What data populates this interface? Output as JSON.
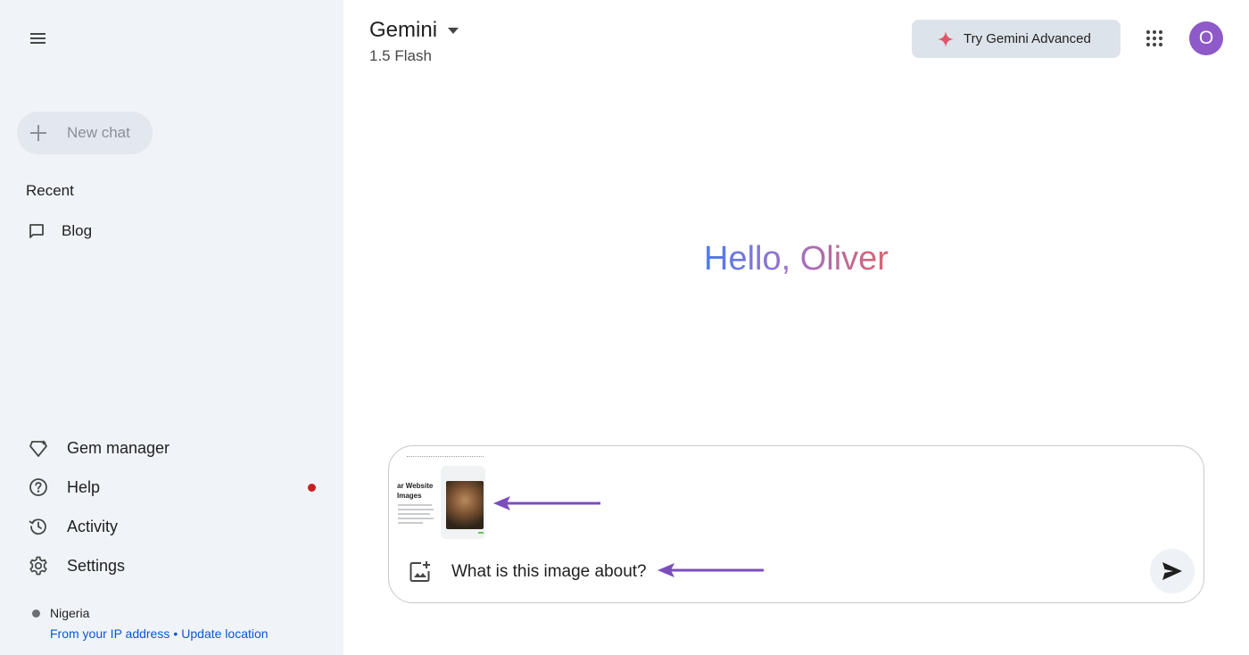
{
  "sidebar": {
    "new_chat_label": "New chat",
    "recent_heading": "Recent",
    "recent_items": [
      {
        "label": "Blog"
      }
    ],
    "links": [
      {
        "label": "Gem manager",
        "icon": "gem-icon"
      },
      {
        "label": "Help",
        "icon": "help-icon",
        "badge": true
      },
      {
        "label": "Activity",
        "icon": "history-icon"
      },
      {
        "label": "Settings",
        "icon": "gear-icon"
      }
    ],
    "location": {
      "country": "Nigeria",
      "source_link": "From your IP address",
      "separator": "•",
      "update_link": "Update location"
    }
  },
  "header": {
    "model_name": "Gemini",
    "model_version": "1.5 Flash",
    "advanced_button_label": "Try Gemini Advanced",
    "avatar_initial": "O"
  },
  "main": {
    "greeting": "Hello, Oliver"
  },
  "prompt": {
    "attachment_title": "r Website\nImages",
    "input_value": "What is this image about?"
  },
  "colors": {
    "sidebar_bg": "#f0f4f9",
    "accent_link": "#0b57d0",
    "avatar_bg": "#8e59c8",
    "annotation_arrow": "#7c4dbc",
    "badge_dot": "#c5221f",
    "sparkle": "#e0546b"
  }
}
